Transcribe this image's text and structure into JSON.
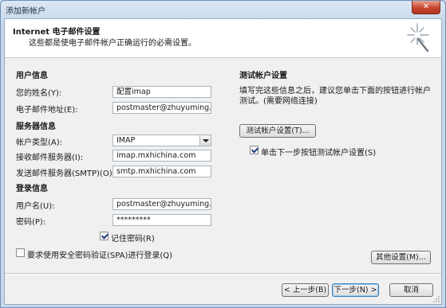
{
  "window": {
    "title": "添加新帐户",
    "close_symbol": "✕"
  },
  "header": {
    "title": "Internet 电子邮件设置",
    "subtitle": "这些都是使电子邮件帐户正确运行的必需设置。",
    "icon": "wizard-sparkle-icon"
  },
  "user_info": {
    "section": "用户信息",
    "name_label": "您的姓名(Y):",
    "name_value": "配置imap",
    "email_label": "电子邮件地址(E):",
    "email_value": "postmaster@zhuyuming.so"
  },
  "server_info": {
    "section": "服务器信息",
    "account_type_label": "帐户类型(A):",
    "account_type_value": "IMAP",
    "incoming_label": "接收邮件服务器(I):",
    "incoming_value": "imap.mxhichina.com",
    "outgoing_label": "发送邮件服务器(SMTP)(O):",
    "outgoing_value": "smtp.mxhichina.com"
  },
  "login_info": {
    "section": "登录信息",
    "username_label": "用户名(U):",
    "username_value": "postmaster@zhuyuming.so",
    "password_label": "密码(P):",
    "password_value": "*********",
    "remember_label": "记住密码(R)",
    "remember_checked": true,
    "spa_label": "要求使用安全密码验证(SPA)进行登录(Q)",
    "spa_checked": false
  },
  "test": {
    "section": "测试帐户设置",
    "description": "填写完这些信息之后，建议您单击下面的按钮进行帐户测试。(需要网络连接)",
    "test_button": "测试帐户设置(T)...",
    "auto_test_label": "单击下一步按钮测试帐户设置(S)",
    "auto_test_checked": true
  },
  "buttons": {
    "more_settings": "其他设置(M)...",
    "back": "< 上一步(B)",
    "next": "下一步(N) >",
    "cancel": "取消"
  }
}
